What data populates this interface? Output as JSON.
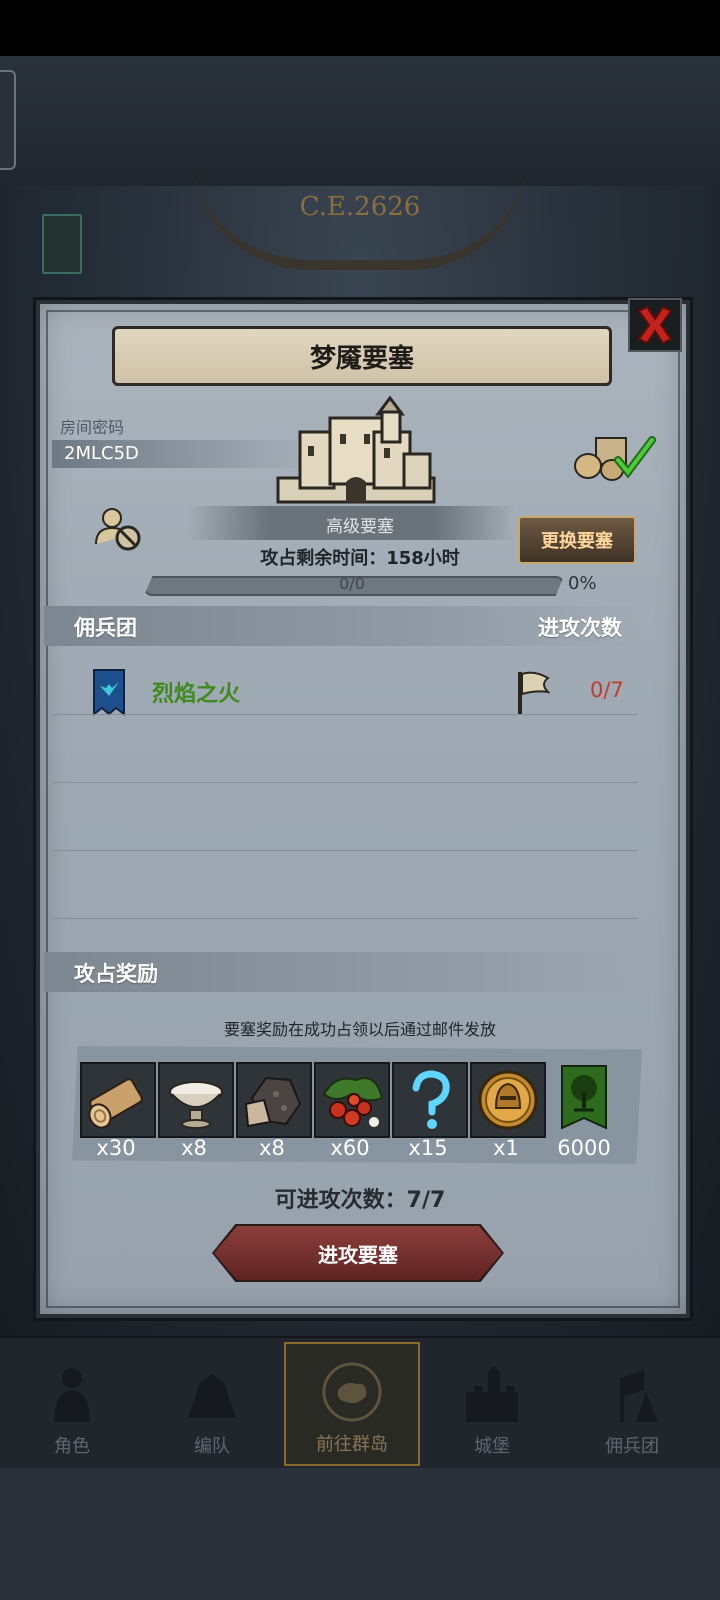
{
  "world": {
    "era": "C.E.2626"
  },
  "modal": {
    "title": "梦魇要塞",
    "room_code_label": "房间密码",
    "room_code": "2MLC5D",
    "fortress_level": "高级要塞",
    "change_button": "更换要塞",
    "time_remaining": "攻占剩余时间：158小时",
    "progress": {
      "text": "0/0",
      "percent_label": "0%",
      "fraction": 0
    },
    "mercenary_header": "佣兵团",
    "attack_count_header": "进攻次数",
    "mercenaries": [
      {
        "name": "烈焰之火",
        "attacks": "0/7",
        "name_color": "#3e8a1c",
        "attacks_color": "#c33a2c"
      }
    ],
    "rewards_header": "攻占奖励",
    "rewards_note": "要塞奖励在成功占领以后通过邮件发放",
    "rewards": [
      {
        "icon": "log-icon",
        "qty": "x30"
      },
      {
        "icon": "bowl-icon",
        "qty": "x8"
      },
      {
        "icon": "ore-icon",
        "qty": "x8"
      },
      {
        "icon": "berries-icon",
        "qty": "x60"
      },
      {
        "icon": "mystery-question-icon",
        "qty": "x15"
      },
      {
        "icon": "helmet-medal-icon",
        "qty": "x1"
      },
      {
        "icon": "guild-banner-icon",
        "qty": "6000"
      }
    ],
    "attack_remaining": "可进攻次数：7/7",
    "attack_button": "进攻要塞"
  },
  "nav": {
    "items": [
      {
        "label": "角色",
        "icon": "character-icon"
      },
      {
        "label": "编队",
        "icon": "squad-icon"
      },
      {
        "label": "前往群岛",
        "icon": "compass-map-icon",
        "active": true
      },
      {
        "label": "城堡",
        "icon": "castle-icon"
      },
      {
        "label": "佣兵团",
        "icon": "mercenary-icon"
      }
    ]
  },
  "colors": {
    "accent_gold": "#c9a46b",
    "panel": "#9ea9b3",
    "danger": "#c33a2c"
  }
}
